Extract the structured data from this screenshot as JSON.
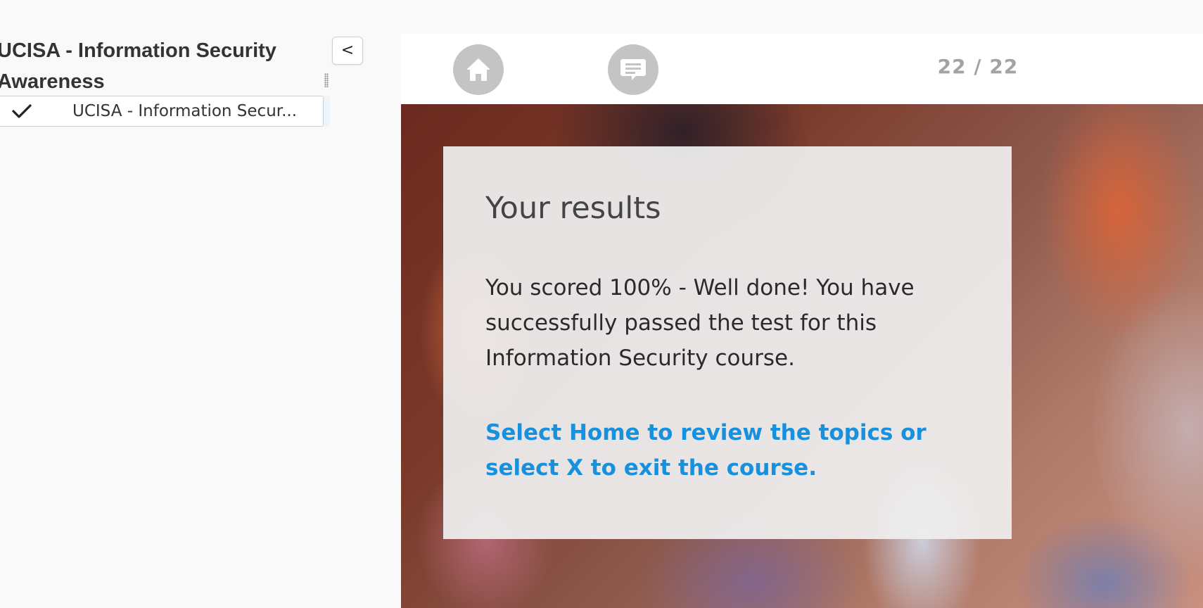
{
  "sidebar": {
    "course_title": "UCISA - Information Security Awareness",
    "collapse_label": "<",
    "items": [
      {
        "label": "UCISA - Information Secur...",
        "completed": true,
        "icon": "checkmark-icon"
      }
    ]
  },
  "toolbar": {
    "home_icon": "home-icon",
    "comment_icon": "comment-icon",
    "page_counter": "22 / 22"
  },
  "content": {
    "heading": "Your results",
    "score_text": "You scored 100% - Well done! You have successfully passed the test for this Information Security course.",
    "instruction": "Select Home to review the topics or select X to exit the course."
  },
  "colors": {
    "accent_blue": "#1791dd",
    "button_gray": "#c4c4c4",
    "counter_gray": "#a3a3a3"
  }
}
